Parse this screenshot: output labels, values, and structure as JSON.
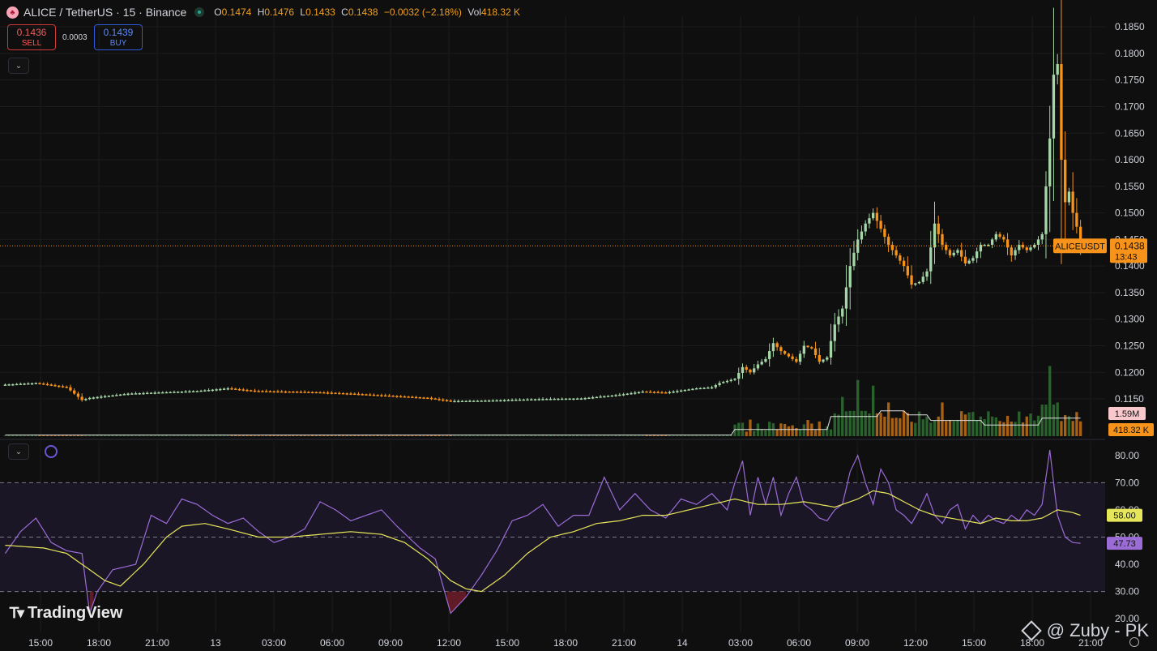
{
  "header": {
    "symbol": "ALICE / TetherUS · 15 · Binance",
    "ohlc": [
      {
        "k": "O",
        "v": "0.1474"
      },
      {
        "k": "H",
        "v": "0.1476"
      },
      {
        "k": "L",
        "v": "0.1433"
      },
      {
        "k": "C",
        "v": "0.1438"
      },
      {
        "k": "",
        "v": "−0.0032 (−2.18%)"
      },
      {
        "k": "Vol",
        "v": "418.32 K"
      }
    ]
  },
  "trade": {
    "sell_price": "0.1436",
    "sell_label": "SELL",
    "spread": "0.0003",
    "buy_price": "0.1439",
    "buy_label": "BUY"
  },
  "watermark": "TradingView",
  "credit": "@ Zuby - PK",
  "colors": {
    "up": "#a5d6a7",
    "down": "#f7931a",
    "vol_up": "#2e6b32",
    "vol_down": "#b86a16",
    "rsi": "#9b6cd6",
    "rsi_ma": "#e6e65a",
    "last_price": "#f7931a"
  },
  "chart_data": [
    {
      "type": "candlestick",
      "symbol": "ALICEUSDT",
      "interval": "15",
      "ylim": [
        0.108,
        0.187
      ],
      "y_ticks": [
        "0.1850",
        "0.1800",
        "0.1750",
        "0.1700",
        "0.1650",
        "0.1600",
        "0.1550",
        "0.1500",
        "0.1450",
        "0.1400",
        "0.1350",
        "0.1300",
        "0.1250",
        "0.1200",
        "0.1150"
      ],
      "y_tick_values": [
        0.185,
        0.18,
        0.175,
        0.17,
        0.165,
        0.16,
        0.155,
        0.15,
        0.145,
        0.14,
        0.135,
        0.13,
        0.125,
        0.12,
        0.115
      ],
      "x_ticks": [
        "15:00",
        "18:00",
        "21:00",
        "13",
        "03:00",
        "06:00",
        "09:00",
        "12:00",
        "15:00",
        "18:00",
        "21:00",
        "14",
        "03:00",
        "06:00",
        "09:00",
        "12:00",
        "15:00",
        "18:00",
        "21:00"
      ],
      "last_price": {
        "label": "ALICEUSDT",
        "value": "0.1438",
        "countdown": "13:43",
        "y": 0.1438
      },
      "keypoints": [
        [
          0,
          0.1177
        ],
        [
          8,
          0.118
        ],
        [
          16,
          0.1172
        ],
        [
          20,
          0.1148
        ],
        [
          22,
          0.1152
        ],
        [
          32,
          0.116
        ],
        [
          50,
          0.1165
        ],
        [
          58,
          0.117
        ],
        [
          65,
          0.1165
        ],
        [
          80,
          0.1163
        ],
        [
          90,
          0.116
        ],
        [
          100,
          0.1156
        ],
        [
          110,
          0.1152
        ],
        [
          116,
          0.1146
        ],
        [
          126,
          0.1147
        ],
        [
          140,
          0.115
        ],
        [
          150,
          0.1151
        ],
        [
          160,
          0.1158
        ],
        [
          166,
          0.1164
        ],
        [
          172,
          0.1162
        ],
        [
          180,
          0.117
        ],
        [
          184,
          0.1172
        ],
        [
          186,
          0.118
        ],
        [
          190,
          0.1188
        ],
        [
          192,
          0.121
        ],
        [
          194,
          0.12
        ],
        [
          196,
          0.1215
        ],
        [
          198,
          0.1225
        ],
        [
          200,
          0.1255
        ],
        [
          202,
          0.124
        ],
        [
          204,
          0.123
        ],
        [
          206,
          0.122
        ],
        [
          208,
          0.125
        ],
        [
          210,
          0.1245
        ],
        [
          212,
          0.122
        ],
        [
          214,
          0.1228
        ],
        [
          216,
          0.129
        ],
        [
          218,
          0.132
        ],
        [
          220,
          0.14
        ],
        [
          222,
          0.145
        ],
        [
          224,
          0.148
        ],
        [
          226,
          0.15
        ],
        [
          228,
          0.147
        ],
        [
          230,
          0.144
        ],
        [
          232,
          0.142
        ],
        [
          234,
          0.14
        ],
        [
          236,
          0.1365
        ],
        [
          238,
          0.137
        ],
        [
          240,
          0.139
        ],
        [
          242,
          0.148
        ],
        [
          244,
          0.144
        ],
        [
          246,
          0.142
        ],
        [
          248,
          0.143
        ],
        [
          250,
          0.1405
        ],
        [
          252,
          0.1415
        ],
        [
          254,
          0.144
        ],
        [
          256,
          0.144
        ],
        [
          258,
          0.146
        ],
        [
          260,
          0.145
        ],
        [
          262,
          0.142
        ],
        [
          264,
          0.144
        ],
        [
          266,
          0.143
        ],
        [
          268,
          0.144
        ],
        [
          270,
          0.146
        ],
        [
          272,
          0.164
        ],
        [
          273,
          0.176
        ],
        [
          274,
          0.178
        ],
        [
          275,
          0.16
        ],
        [
          276,
          0.152
        ],
        [
          277,
          0.154
        ],
        [
          278,
          0.15
        ],
        [
          279,
          0.1474
        ],
        [
          280,
          0.1438
        ]
      ],
      "count": 281
    },
    {
      "type": "bar",
      "name": "volume",
      "labels": [
        "1.59M",
        "418.32 K"
      ],
      "spikes": [
        [
          218,
          0.7
        ],
        [
          222,
          1.0
        ],
        [
          226,
          0.9
        ],
        [
          230,
          0.6
        ],
        [
          234,
          0.45
        ],
        [
          244,
          0.6
        ],
        [
          254,
          0.35
        ],
        [
          266,
          0.35
        ],
        [
          272,
          1.25
        ],
        [
          274,
          0.6
        ]
      ]
    },
    {
      "type": "line",
      "name": "RSI",
      "ylim": [
        15,
        85
      ],
      "y_ticks": [
        "80.00",
        "70.00",
        "60.00",
        "50.00",
        "40.00",
        "30.00",
        "20.00"
      ],
      "y_tick_values": [
        80,
        70,
        60,
        50,
        40,
        30,
        20
      ],
      "bands": [
        30,
        50,
        70
      ],
      "rsi_label": "47.73",
      "ma_label": "58.00",
      "keypoints": [
        [
          0,
          44
        ],
        [
          4,
          52
        ],
        [
          8,
          57
        ],
        [
          12,
          48
        ],
        [
          16,
          45
        ],
        [
          20,
          44
        ],
        [
          22,
          22
        ],
        [
          24,
          30
        ],
        [
          28,
          38
        ],
        [
          34,
          40
        ],
        [
          38,
          58
        ],
        [
          42,
          55
        ],
        [
          46,
          64
        ],
        [
          50,
          62
        ],
        [
          54,
          58
        ],
        [
          58,
          55
        ],
        [
          62,
          57
        ],
        [
          66,
          52
        ],
        [
          70,
          48
        ],
        [
          74,
          50
        ],
        [
          78,
          53
        ],
        [
          82,
          63
        ],
        [
          86,
          60
        ],
        [
          90,
          56
        ],
        [
          94,
          58
        ],
        [
          98,
          60
        ],
        [
          102,
          54
        ],
        [
          108,
          46
        ],
        [
          112,
          42
        ],
        [
          116,
          22
        ],
        [
          120,
          28
        ],
        [
          124,
          36
        ],
        [
          128,
          45
        ],
        [
          132,
          56
        ],
        [
          136,
          58
        ],
        [
          140,
          62
        ],
        [
          144,
          54
        ],
        [
          148,
          58
        ],
        [
          152,
          58
        ],
        [
          156,
          72
        ],
        [
          160,
          60
        ],
        [
          164,
          66
        ],
        [
          168,
          60
        ],
        [
          172,
          57
        ],
        [
          176,
          64
        ],
        [
          180,
          62
        ],
        [
          184,
          66
        ],
        [
          188,
          60
        ],
        [
          190,
          70
        ],
        [
          192,
          78
        ],
        [
          194,
          58
        ],
        [
          196,
          72
        ],
        [
          198,
          62
        ],
        [
          200,
          72
        ],
        [
          202,
          58
        ],
        [
          204,
          66
        ],
        [
          206,
          72
        ],
        [
          208,
          62
        ],
        [
          210,
          60
        ],
        [
          212,
          57
        ],
        [
          214,
          56
        ],
        [
          216,
          60
        ],
        [
          218,
          62
        ],
        [
          220,
          74
        ],
        [
          222,
          80
        ],
        [
          224,
          70
        ],
        [
          226,
          62
        ],
        [
          228,
          75
        ],
        [
          230,
          70
        ],
        [
          232,
          60
        ],
        [
          234,
          58
        ],
        [
          236,
          55
        ],
        [
          238,
          60
        ],
        [
          240,
          66
        ],
        [
          242,
          58
        ],
        [
          244,
          55
        ],
        [
          246,
          60
        ],
        [
          248,
          62
        ],
        [
          250,
          53
        ],
        [
          252,
          58
        ],
        [
          254,
          55
        ],
        [
          256,
          58
        ],
        [
          258,
          56
        ],
        [
          260,
          55
        ],
        [
          262,
          58
        ],
        [
          264,
          56
        ],
        [
          266,
          60
        ],
        [
          268,
          58
        ],
        [
          270,
          62
        ],
        [
          272,
          82
        ],
        [
          274,
          58
        ],
        [
          276,
          50
        ],
        [
          278,
          48
        ],
        [
          280,
          47.73
        ]
      ],
      "ma_keypoints": [
        [
          0,
          47
        ],
        [
          10,
          46
        ],
        [
          16,
          44
        ],
        [
          22,
          38
        ],
        [
          26,
          34
        ],
        [
          30,
          32
        ],
        [
          36,
          40
        ],
        [
          42,
          50
        ],
        [
          46,
          54
        ],
        [
          52,
          55
        ],
        [
          58,
          53
        ],
        [
          66,
          50
        ],
        [
          74,
          50
        ],
        [
          82,
          51
        ],
        [
          90,
          52
        ],
        [
          98,
          51
        ],
        [
          104,
          48
        ],
        [
          110,
          42
        ],
        [
          116,
          34
        ],
        [
          120,
          31
        ],
        [
          124,
          30
        ],
        [
          130,
          36
        ],
        [
          136,
          44
        ],
        [
          142,
          50
        ],
        [
          148,
          52
        ],
        [
          154,
          55
        ],
        [
          160,
          56
        ],
        [
          166,
          58
        ],
        [
          172,
          58
        ],
        [
          178,
          60
        ],
        [
          184,
          62
        ],
        [
          190,
          64
        ],
        [
          196,
          62
        ],
        [
          202,
          62
        ],
        [
          208,
          63
        ],
        [
          212,
          62
        ],
        [
          216,
          61
        ],
        [
          222,
          64
        ],
        [
          226,
          67
        ],
        [
          230,
          66
        ],
        [
          234,
          63
        ],
        [
          238,
          60
        ],
        [
          242,
          58
        ],
        [
          246,
          57
        ],
        [
          250,
          56
        ],
        [
          254,
          55
        ],
        [
          258,
          57
        ],
        [
          262,
          56
        ],
        [
          266,
          56
        ],
        [
          270,
          57
        ],
        [
          274,
          60
        ],
        [
          278,
          59
        ],
        [
          280,
          58
        ]
      ],
      "count": 281
    }
  ]
}
